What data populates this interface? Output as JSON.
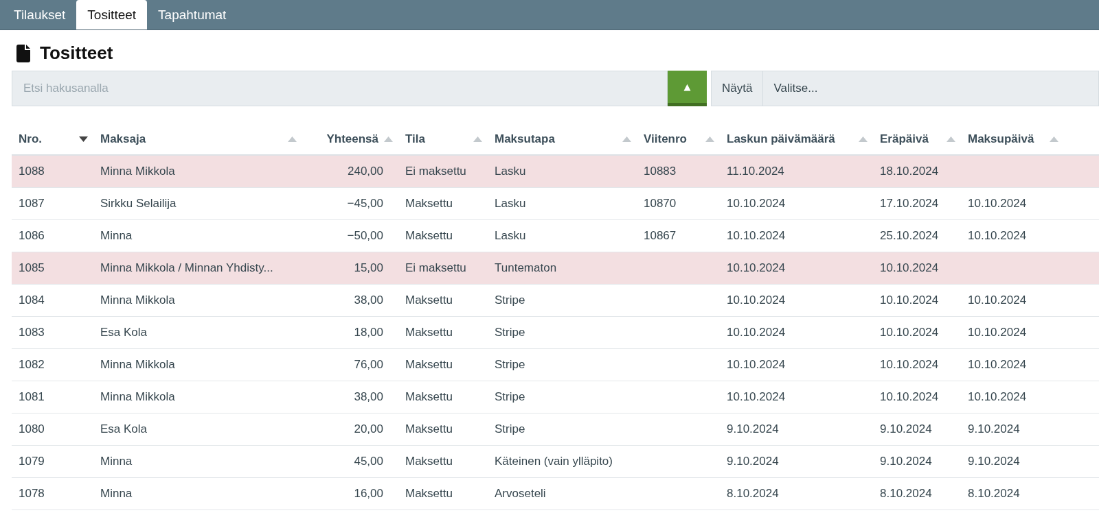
{
  "tabs": [
    {
      "label": "Tilaukset",
      "selected": false
    },
    {
      "label": "Tositteet",
      "selected": true
    },
    {
      "label": "Tapahtumat",
      "selected": false
    }
  ],
  "page_title": "Tositteet",
  "search": {
    "placeholder": "Etsi hakusanalla",
    "toggle": "▲"
  },
  "filter": {
    "label": "Näytä",
    "value": "Valitse..."
  },
  "table": {
    "columns": [
      {
        "label": "Nro.",
        "sorted": true,
        "kind": "text"
      },
      {
        "label": "Maksaja",
        "sorted": false,
        "kind": "text"
      },
      {
        "label": "Yhteensä",
        "sorted": false,
        "kind": "amount"
      },
      {
        "label": "Tila",
        "sorted": false,
        "kind": "text"
      },
      {
        "label": "Maksutapa",
        "sorted": false,
        "kind": "text"
      },
      {
        "label": "Viitenro",
        "sorted": false,
        "kind": "text"
      },
      {
        "label": "Laskun päivämäärä",
        "sorted": false,
        "kind": "text"
      },
      {
        "label": "Eräpäivä",
        "sorted": false,
        "kind": "text"
      },
      {
        "label": "Maksupäivä",
        "sorted": false,
        "kind": "text"
      }
    ],
    "rows": [
      {
        "highlighted": true,
        "cells": [
          "1088",
          "Minna Mikkola",
          "240,00",
          "Ei maksettu",
          "Lasku",
          "10883",
          "11.10.2024",
          "18.10.2024",
          ""
        ]
      },
      {
        "highlighted": false,
        "cells": [
          "1087",
          "Sirkku Selailija",
          "−45,00",
          "Maksettu",
          "Lasku",
          "10870",
          "10.10.2024",
          "17.10.2024",
          "10.10.2024"
        ]
      },
      {
        "highlighted": false,
        "cells": [
          "1086",
          "Minna",
          "−50,00",
          "Maksettu",
          "Lasku",
          "10867",
          "10.10.2024",
          "25.10.2024",
          "10.10.2024"
        ]
      },
      {
        "highlighted": true,
        "cells": [
          "1085",
          "Minna Mikkola / Minnan Yhdisty...",
          "15,00",
          "Ei maksettu",
          "Tuntematon",
          "",
          "10.10.2024",
          "10.10.2024",
          ""
        ]
      },
      {
        "highlighted": false,
        "cells": [
          "1084",
          "Minna Mikkola",
          "38,00",
          "Maksettu",
          "Stripe",
          "",
          "10.10.2024",
          "10.10.2024",
          "10.10.2024"
        ]
      },
      {
        "highlighted": false,
        "cells": [
          "1083",
          "Esa Kola",
          "18,00",
          "Maksettu",
          "Stripe",
          "",
          "10.10.2024",
          "10.10.2024",
          "10.10.2024"
        ]
      },
      {
        "highlighted": false,
        "cells": [
          "1082",
          "Minna Mikkola",
          "76,00",
          "Maksettu",
          "Stripe",
          "",
          "10.10.2024",
          "10.10.2024",
          "10.10.2024"
        ]
      },
      {
        "highlighted": false,
        "cells": [
          "1081",
          "Minna Mikkola",
          "38,00",
          "Maksettu",
          "Stripe",
          "",
          "10.10.2024",
          "10.10.2024",
          "10.10.2024"
        ]
      },
      {
        "highlighted": false,
        "cells": [
          "1080",
          "Esa Kola",
          "20,00",
          "Maksettu",
          "Stripe",
          "",
          "9.10.2024",
          "9.10.2024",
          "9.10.2024"
        ]
      },
      {
        "highlighted": false,
        "cells": [
          "1079",
          "Minna",
          "45,00",
          "Maksettu",
          "Käteinen (vain ylläpito)",
          "",
          "9.10.2024",
          "9.10.2024",
          "9.10.2024"
        ]
      },
      {
        "highlighted": false,
        "cells": [
          "1078",
          "Minna",
          "16,00",
          "Maksettu",
          "Arvoseteli",
          "",
          "8.10.2024",
          "8.10.2024",
          "8.10.2024"
        ]
      }
    ]
  }
}
